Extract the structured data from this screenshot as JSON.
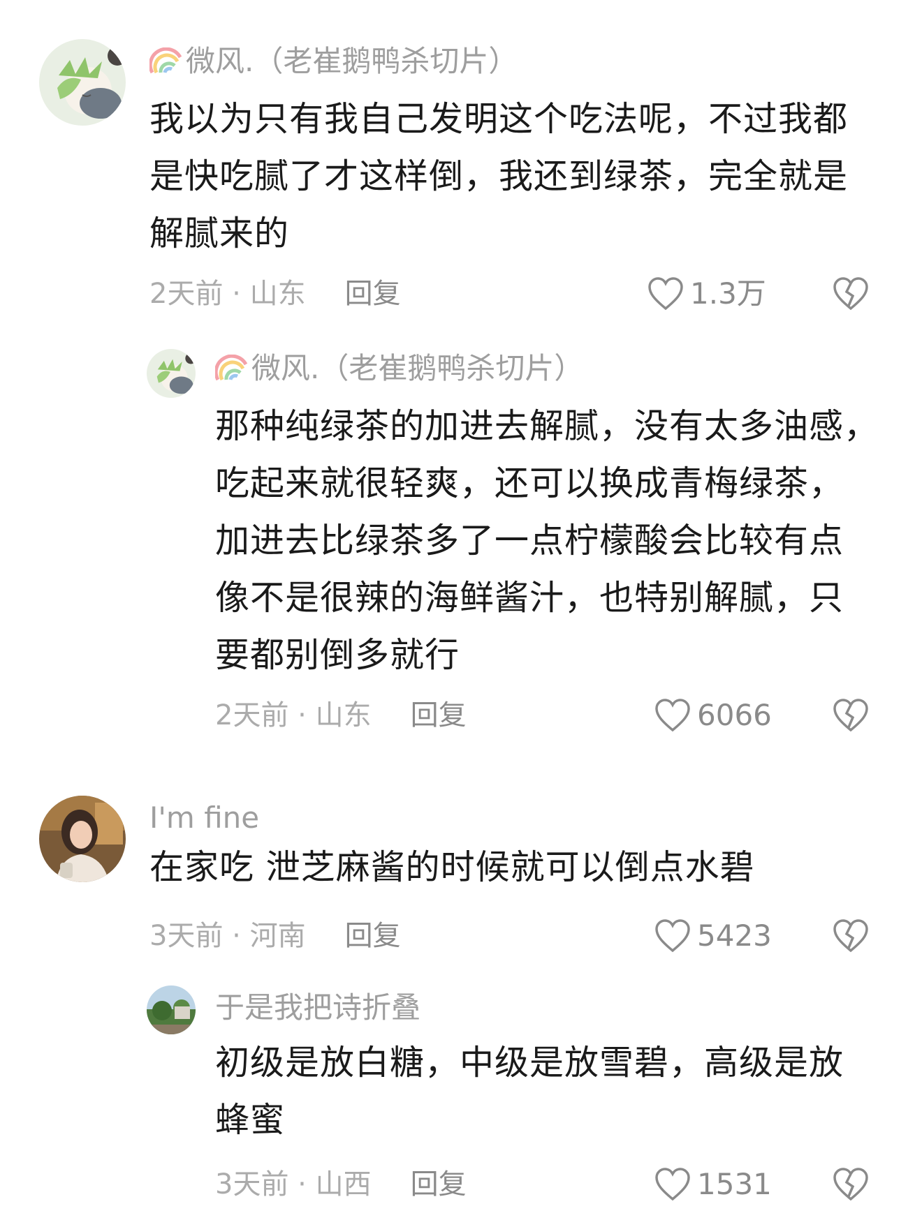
{
  "colors": {
    "author_gray": "#9e9e9e",
    "meta_gray": "#ababab",
    "text_dark": "#1a1a1a",
    "icon_gray": "#8a8a8a"
  },
  "comments": [
    {
      "author": "微风.（老崔鹅鸭杀切片）",
      "author_prefix_icon": "rainbow-icon",
      "avatar": "anime-girl-avatar",
      "lines": [
        "我以为只有我自己发明这个吃法呢，不过我都",
        "是快吃腻了才这样倒，我还到绿茶，完全就是",
        "解腻来的"
      ],
      "time_location": "2天前 · 山东",
      "reply_label": "回复",
      "likes": "1.3万"
    },
    {
      "author": "微风.（老崔鹅鸭杀切片）",
      "author_prefix_icon": "rainbow-icon",
      "avatar": "anime-girl-avatar",
      "lines": [
        "那种纯绿茶的加进去解腻，没有太多油感，",
        "吃起来就很轻爽，还可以换成青梅绿茶，",
        "加进去比绿茶多了一点柠檬酸会比较有点",
        "像不是很辣的海鲜酱汁，也特别解腻，只",
        "要都别倒多就行"
      ],
      "time_location": "2天前 · 山东",
      "reply_label": "回复",
      "likes": "6066"
    },
    {
      "author": "I'm fine",
      "avatar": "woman-photo-avatar",
      "lines": [
        "在家吃 泄芝麻酱的时候就可以倒点水碧"
      ],
      "time_location": "3天前 · 河南",
      "reply_label": "回复",
      "likes": "5423"
    },
    {
      "author": "于是我把诗折叠",
      "avatar": "landscape-photo-avatar",
      "lines": [
        "初级是放白糖，中级是放雪碧，高级是放",
        "蜂蜜"
      ],
      "time_location": "3天前 · 山西",
      "reply_label": "回复",
      "likes": "1531"
    }
  ]
}
